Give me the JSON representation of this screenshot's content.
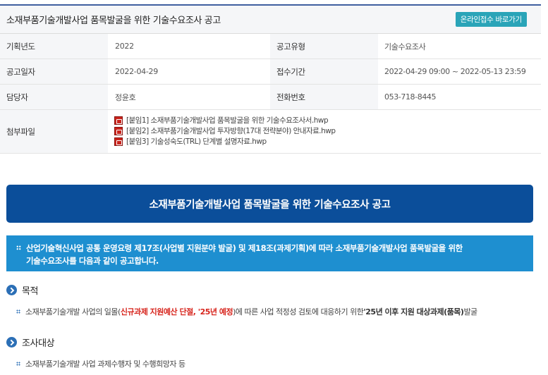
{
  "header": {
    "title": "소재부품기술개발사업 품목발굴을 위한 기술수요조사 공고",
    "online_button": "온라인접수 바로가기"
  },
  "info": {
    "year_label": "기획년도",
    "year_value": "2022",
    "type_label": "공고유형",
    "type_value": "기술수요조사",
    "date_label": "공고일자",
    "date_value": "2022-04-29",
    "period_label": "접수기간",
    "period_value": "2022-04-29 09:00 ~ 2022-05-13 23:59",
    "manager_label": "담당자",
    "manager_value": "정윤호",
    "phone_label": "전화번호",
    "phone_value": "053-718-8445",
    "files_label": "첨부파일",
    "files": [
      "[붙임1] 소재부품기술개발사업 품목발굴을 위한 기술수요조사서.hwp",
      "[붙임2] 소재부품기술개발사업 투자방향(17대 전략분야) 안내자료.hwp",
      "[붙임3] 기술성숙도(TRL) 단계별 설명자료.hwp"
    ]
  },
  "banner": {
    "title": "소재부품기술개발사업 품목발굴을 위한 기술수요조사 공고"
  },
  "notice": {
    "line1": "산업기술혁신사업 공통 운영요령 제17조(사업별 지원분야 발굴) 및 제18조(과제기획)에 따라 소재부품기술개발사업 품목발굴을 위한",
    "line2": "기술수요조사를 다음과 같이 공고합니다."
  },
  "sections": {
    "purpose": {
      "heading": "목적",
      "text_a": "소재부품기술개발 사업의 일몰(",
      "text_red": "신규과제 지원예산 단절, '25년 예정",
      "text_b": ")에 따른 사업 적정성 검토에 대응하기 위한 ",
      "text_bold": "'25년 이후 지원 대상과제(품목)",
      "text_c": " 발굴"
    },
    "target": {
      "heading": "조사대상",
      "text": "소재부품기술개발 사업 과제수행자 및 수행희망자 등"
    }
  }
}
